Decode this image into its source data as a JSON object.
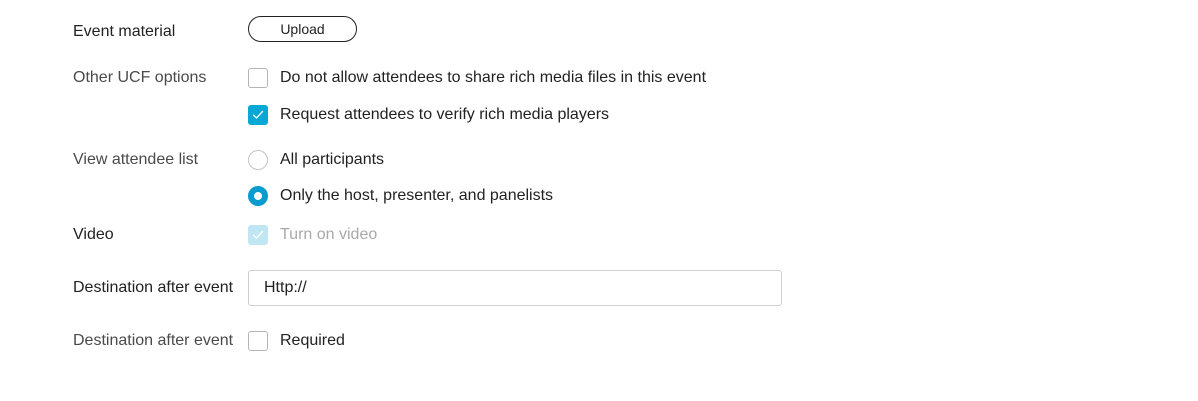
{
  "event_material": {
    "label": "Event material",
    "upload_label": "Upload"
  },
  "ucf_options": {
    "label": "Other UCF options",
    "items": [
      {
        "label": "Do not allow attendees to share rich media files in this event",
        "checked": false
      },
      {
        "label": "Request attendees to verify rich media players",
        "checked": true
      }
    ]
  },
  "attendee_list": {
    "label": "View attendee list",
    "options": [
      {
        "label": "All participants",
        "selected": false
      },
      {
        "label": "Only the host, presenter, and panelists",
        "selected": true
      }
    ]
  },
  "video": {
    "label": "Video",
    "option_label": "Turn on video",
    "checked": true,
    "disabled": true
  },
  "destination_url": {
    "label": "Destination after event",
    "value": "Http://"
  },
  "destination_required": {
    "label": "Destination after event",
    "option_label": "Required",
    "checked": false
  },
  "colors": {
    "accent": "#07a8d6",
    "radio_selected": "#0a9ccf",
    "disabled_check": "#bfe6f2"
  },
  "icons": {
    "check": "checkmark-icon"
  }
}
